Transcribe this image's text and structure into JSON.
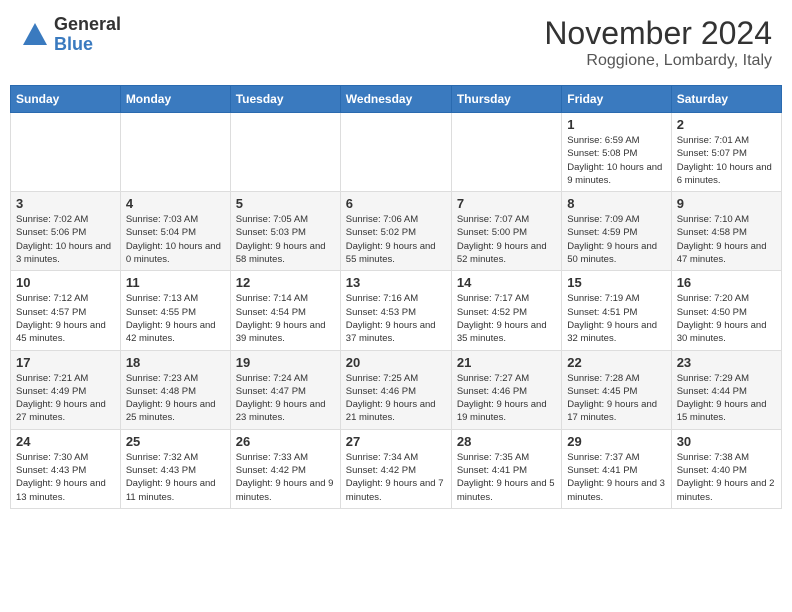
{
  "logo": {
    "general": "General",
    "blue": "Blue"
  },
  "title": "November 2024",
  "location": "Roggione, Lombardy, Italy",
  "days_of_week": [
    "Sunday",
    "Monday",
    "Tuesday",
    "Wednesday",
    "Thursday",
    "Friday",
    "Saturday"
  ],
  "weeks": [
    [
      {
        "day": "",
        "info": ""
      },
      {
        "day": "",
        "info": ""
      },
      {
        "day": "",
        "info": ""
      },
      {
        "day": "",
        "info": ""
      },
      {
        "day": "",
        "info": ""
      },
      {
        "day": "1",
        "info": "Sunrise: 6:59 AM\nSunset: 5:08 PM\nDaylight: 10 hours and 9 minutes."
      },
      {
        "day": "2",
        "info": "Sunrise: 7:01 AM\nSunset: 5:07 PM\nDaylight: 10 hours and 6 minutes."
      }
    ],
    [
      {
        "day": "3",
        "info": "Sunrise: 7:02 AM\nSunset: 5:06 PM\nDaylight: 10 hours and 3 minutes."
      },
      {
        "day": "4",
        "info": "Sunrise: 7:03 AM\nSunset: 5:04 PM\nDaylight: 10 hours and 0 minutes."
      },
      {
        "day": "5",
        "info": "Sunrise: 7:05 AM\nSunset: 5:03 PM\nDaylight: 9 hours and 58 minutes."
      },
      {
        "day": "6",
        "info": "Sunrise: 7:06 AM\nSunset: 5:02 PM\nDaylight: 9 hours and 55 minutes."
      },
      {
        "day": "7",
        "info": "Sunrise: 7:07 AM\nSunset: 5:00 PM\nDaylight: 9 hours and 52 minutes."
      },
      {
        "day": "8",
        "info": "Sunrise: 7:09 AM\nSunset: 4:59 PM\nDaylight: 9 hours and 50 minutes."
      },
      {
        "day": "9",
        "info": "Sunrise: 7:10 AM\nSunset: 4:58 PM\nDaylight: 9 hours and 47 minutes."
      }
    ],
    [
      {
        "day": "10",
        "info": "Sunrise: 7:12 AM\nSunset: 4:57 PM\nDaylight: 9 hours and 45 minutes."
      },
      {
        "day": "11",
        "info": "Sunrise: 7:13 AM\nSunset: 4:55 PM\nDaylight: 9 hours and 42 minutes."
      },
      {
        "day": "12",
        "info": "Sunrise: 7:14 AM\nSunset: 4:54 PM\nDaylight: 9 hours and 39 minutes."
      },
      {
        "day": "13",
        "info": "Sunrise: 7:16 AM\nSunset: 4:53 PM\nDaylight: 9 hours and 37 minutes."
      },
      {
        "day": "14",
        "info": "Sunrise: 7:17 AM\nSunset: 4:52 PM\nDaylight: 9 hours and 35 minutes."
      },
      {
        "day": "15",
        "info": "Sunrise: 7:19 AM\nSunset: 4:51 PM\nDaylight: 9 hours and 32 minutes."
      },
      {
        "day": "16",
        "info": "Sunrise: 7:20 AM\nSunset: 4:50 PM\nDaylight: 9 hours and 30 minutes."
      }
    ],
    [
      {
        "day": "17",
        "info": "Sunrise: 7:21 AM\nSunset: 4:49 PM\nDaylight: 9 hours and 27 minutes."
      },
      {
        "day": "18",
        "info": "Sunrise: 7:23 AM\nSunset: 4:48 PM\nDaylight: 9 hours and 25 minutes."
      },
      {
        "day": "19",
        "info": "Sunrise: 7:24 AM\nSunset: 4:47 PM\nDaylight: 9 hours and 23 minutes."
      },
      {
        "day": "20",
        "info": "Sunrise: 7:25 AM\nSunset: 4:46 PM\nDaylight: 9 hours and 21 minutes."
      },
      {
        "day": "21",
        "info": "Sunrise: 7:27 AM\nSunset: 4:46 PM\nDaylight: 9 hours and 19 minutes."
      },
      {
        "day": "22",
        "info": "Sunrise: 7:28 AM\nSunset: 4:45 PM\nDaylight: 9 hours and 17 minutes."
      },
      {
        "day": "23",
        "info": "Sunrise: 7:29 AM\nSunset: 4:44 PM\nDaylight: 9 hours and 15 minutes."
      }
    ],
    [
      {
        "day": "24",
        "info": "Sunrise: 7:30 AM\nSunset: 4:43 PM\nDaylight: 9 hours and 13 minutes."
      },
      {
        "day": "25",
        "info": "Sunrise: 7:32 AM\nSunset: 4:43 PM\nDaylight: 9 hours and 11 minutes."
      },
      {
        "day": "26",
        "info": "Sunrise: 7:33 AM\nSunset: 4:42 PM\nDaylight: 9 hours and 9 minutes."
      },
      {
        "day": "27",
        "info": "Sunrise: 7:34 AM\nSunset: 4:42 PM\nDaylight: 9 hours and 7 minutes."
      },
      {
        "day": "28",
        "info": "Sunrise: 7:35 AM\nSunset: 4:41 PM\nDaylight: 9 hours and 5 minutes."
      },
      {
        "day": "29",
        "info": "Sunrise: 7:37 AM\nSunset: 4:41 PM\nDaylight: 9 hours and 3 minutes."
      },
      {
        "day": "30",
        "info": "Sunrise: 7:38 AM\nSunset: 4:40 PM\nDaylight: 9 hours and 2 minutes."
      }
    ]
  ]
}
